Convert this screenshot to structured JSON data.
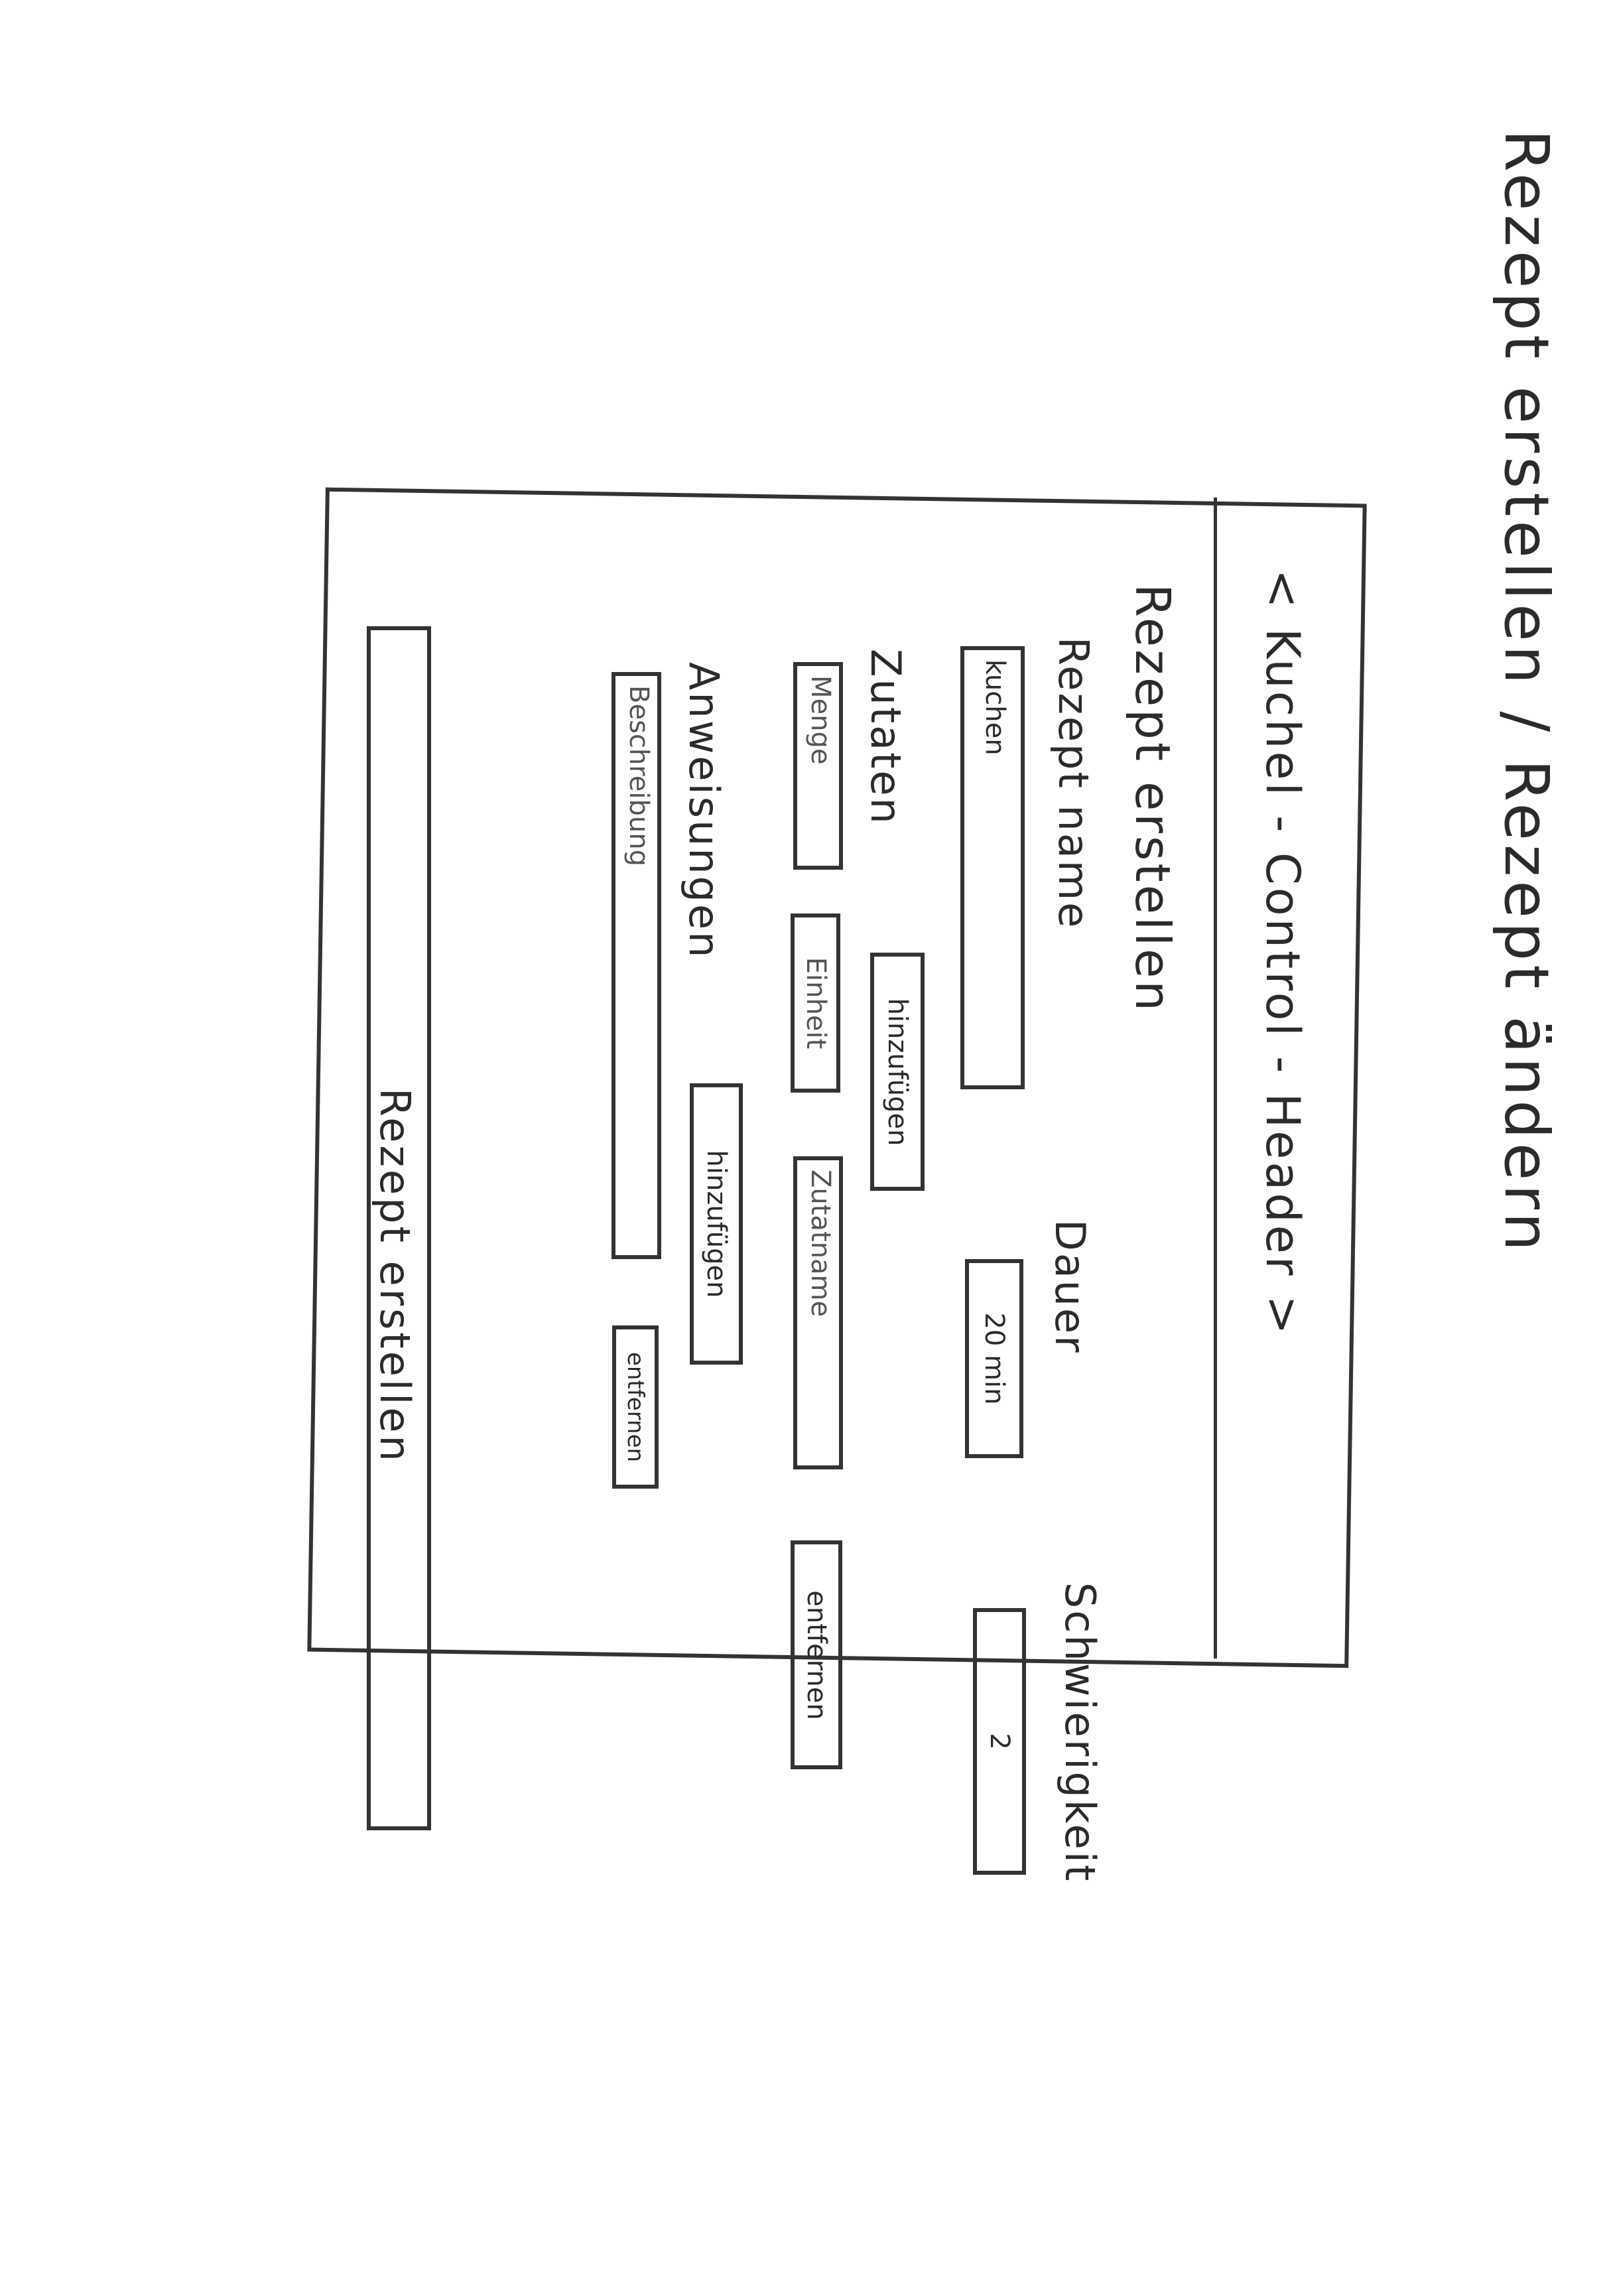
{
  "page": {
    "title": "Rezept erstellen / Rezept ändern"
  },
  "app": {
    "header": "< Kuchel - Control - Header >",
    "heading": "Rezept erstellen"
  },
  "form": {
    "recipe_name": {
      "label": "Rezept name",
      "value": "kuchen"
    },
    "duration": {
      "label": "Dauer",
      "value": "20 min"
    },
    "difficulty": {
      "label": "Schwierigkeit",
      "value": "2"
    },
    "ingredients": {
      "label": "Zutaten",
      "add_label": "hinzufügen",
      "row": {
        "amount_placeholder": "Menge",
        "unit_placeholder": "Einheit",
        "name_placeholder": "Zutatname",
        "remove_label": "entfernen"
      }
    },
    "instructions": {
      "label": "Anweisungen",
      "add_label": "hinzufügen",
      "row": {
        "description_placeholder": "Beschreibung",
        "remove_label": "entfernen"
      }
    },
    "submit_label": "Rezept erstellen"
  }
}
